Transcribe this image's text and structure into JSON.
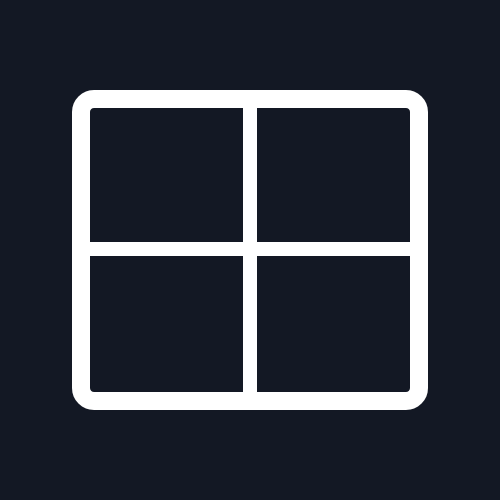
{
  "icon": {
    "name": "grid-icon",
    "description_color": "#ffffff"
  },
  "colors": {
    "background": "#131824",
    "icon_stroke": "#ffffff"
  }
}
